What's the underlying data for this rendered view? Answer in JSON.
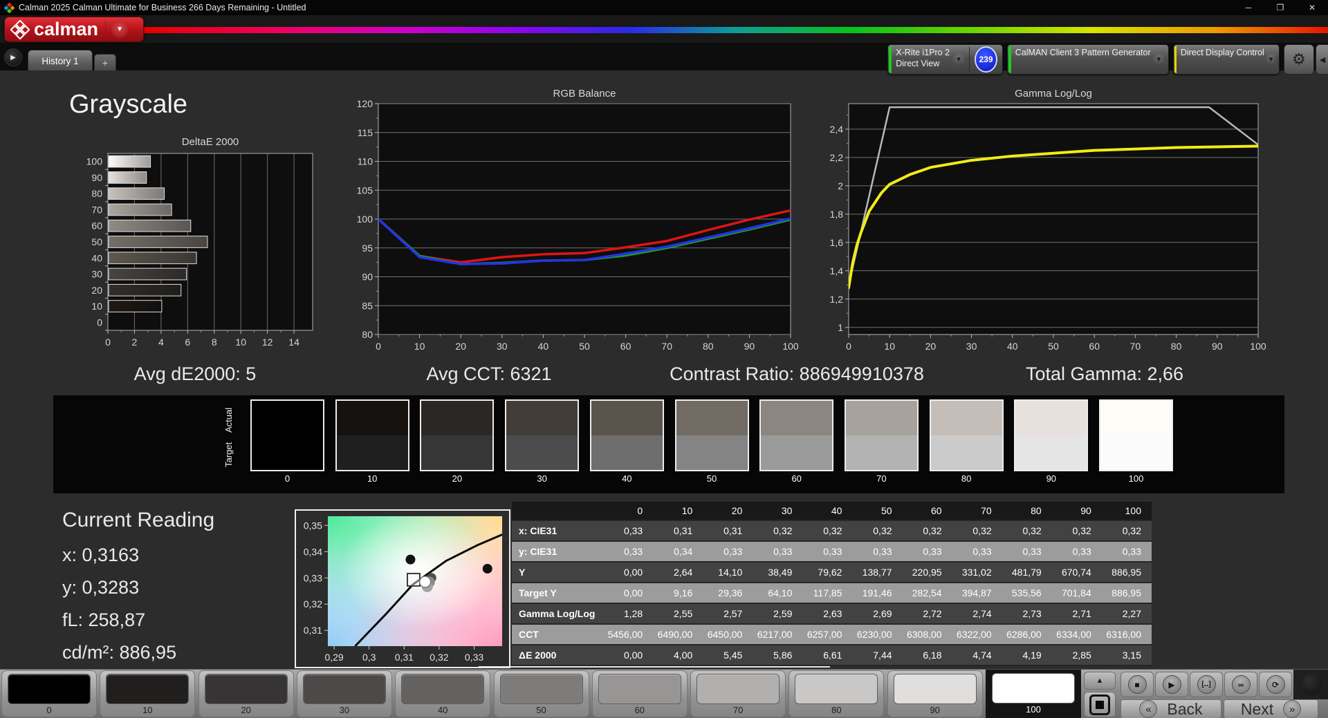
{
  "window": {
    "title": "Calman 2025 Calman Ultimate for Business 266 Days Remaining  - Untitled",
    "controls": [
      {
        "name": "minimize-button",
        "glyph": "─"
      },
      {
        "name": "maximize-button",
        "glyph": "❐"
      },
      {
        "name": "close-button",
        "glyph": "✕"
      }
    ]
  },
  "header": {
    "logo_text": "calman",
    "logo_caret_glyph": "▼",
    "panel_toggle_glyph": "▶",
    "tab": "History 1",
    "add_tab": "+",
    "gear_glyph": "⚙",
    "edge_glyph": "◀",
    "devices": [
      {
        "name": "meter-dropdown",
        "stripe": "#1ecb1e",
        "lines": [
          "X-Rite i1Pro 2",
          "Direct View"
        ],
        "badge": "239"
      },
      {
        "name": "pattern-generator-dropdown",
        "stripe": "#1ecb1e",
        "lines": [
          "CalMAN Client 3 Pattern Generator"
        ]
      },
      {
        "name": "display-control-dropdown",
        "stripe": "#e3d400",
        "lines": [
          "Direct Display Control"
        ]
      }
    ]
  },
  "page": {
    "title": "Grayscale"
  },
  "stats": {
    "avg_de": "Avg dE2000: 5",
    "avg_cct": "Avg CCT: 6321",
    "contrast": "Contrast Ratio: 886949910378",
    "total_gamma": "Total Gamma: 2,66"
  },
  "current_reading": {
    "title": "Current Reading",
    "x": "x: 0,3163",
    "y": "y: 0,3283",
    "fl": "fL: 258,87",
    "cdm2": "cd/m²: 886,95"
  },
  "swatch_strip": {
    "row_labels": [
      "Actual",
      "Target"
    ],
    "levels": [
      {
        "label": "0",
        "actual": "#000000",
        "target": "#000000"
      },
      {
        "label": "10",
        "actual": "#161210",
        "target": "#1f1f1f"
      },
      {
        "label": "20",
        "actual": "#2b2724",
        "target": "#363636"
      },
      {
        "label": "30",
        "actual": "#423d38",
        "target": "#4c4c4c"
      },
      {
        "label": "40",
        "actual": "#5a544d",
        "target": "#6e6e6e"
      },
      {
        "label": "50",
        "actual": "#716b64",
        "target": "#848484"
      },
      {
        "label": "60",
        "actual": "#8c8680",
        "target": "#9b9b9b"
      },
      {
        "label": "70",
        "actual": "#a8a29c",
        "target": "#b3b3b3"
      },
      {
        "label": "80",
        "actual": "#c5beb8",
        "target": "#cbcbcb"
      },
      {
        "label": "90",
        "actual": "#e7e0dc",
        "target": "#e5e5e5"
      },
      {
        "label": "100",
        "actual": "#fffbf7",
        "target": "#fbfbfb"
      }
    ]
  },
  "chart_data": [
    {
      "id": "deltae",
      "type": "bar",
      "orientation": "horizontal",
      "title": "DeltaE 2000",
      "categories": [
        "0",
        "10",
        "20",
        "30",
        "40",
        "50",
        "60",
        "70",
        "80",
        "90",
        "100"
      ],
      "values": [
        0.0,
        4.0,
        5.45,
        5.86,
        6.61,
        7.44,
        6.18,
        4.74,
        4.19,
        2.85,
        3.15
      ],
      "xlim": [
        0,
        15.4
      ],
      "xticks": [
        0,
        2,
        4,
        6,
        8,
        10,
        12,
        14
      ],
      "bar_colors": [
        "#0a0a0a",
        "#1d1916",
        "#322e2a",
        "#48443f",
        "#5e5750",
        "#766f68",
        "#918b85",
        "#aca69f",
        "#c9c2bc",
        "#e7e0db",
        "#fffbf8"
      ],
      "grid": "vertical"
    },
    {
      "id": "rgb-balance",
      "type": "line",
      "title": "RGB Balance",
      "x": [
        0,
        10,
        20,
        30,
        40,
        50,
        60,
        70,
        80,
        90,
        100
      ],
      "ylim": [
        80,
        120
      ],
      "yticks": [
        80,
        85,
        90,
        95,
        100,
        105,
        110,
        115,
        120
      ],
      "ytick_labels": [
        "80",
        "85",
        "90",
        "95",
        "100",
        "105",
        "110",
        "115",
        "120"
      ],
      "xticks": [
        0,
        10,
        20,
        30,
        40,
        50,
        60,
        70,
        80,
        90,
        100
      ],
      "grid": "horizontal",
      "series": [
        {
          "name": "Red",
          "color": "#e11414",
          "values": [
            100,
            93.6,
            92.5,
            93.4,
            93.9,
            94.1,
            95.1,
            96.2,
            98.1,
            99.9,
            101.5
          ]
        },
        {
          "name": "Green",
          "color": "#1ca01c",
          "values": [
            100,
            93.6,
            92.2,
            92.4,
            92.8,
            92.9,
            93.7,
            95.0,
            96.6,
            98.2,
            99.9
          ]
        },
        {
          "name": "Blue",
          "color": "#2432e8",
          "values": [
            100,
            93.4,
            92.2,
            92.3,
            92.8,
            92.9,
            94.0,
            95.2,
            96.8,
            98.4,
            100.1
          ]
        }
      ]
    },
    {
      "id": "gamma",
      "type": "line",
      "title": "Gamma Log/Log",
      "ylim": [
        0.95,
        2.58
      ],
      "yticks": [
        1,
        1.2,
        1.4,
        1.6,
        1.8,
        2,
        2.2,
        2.4
      ],
      "ytick_labels": [
        "1",
        "1,2",
        "1,4",
        "1,6",
        "1,8",
        "2",
        "2,2",
        "2,4"
      ],
      "xticks": [
        0,
        10,
        20,
        30,
        40,
        50,
        60,
        70,
        80,
        90,
        100
      ],
      "grid": "horizontal",
      "series": [
        {
          "name": "Target",
          "color": "#b8b8b8",
          "width": 2.5,
          "x": [
            0,
            10,
            88,
            100
          ],
          "values": [
            1.3,
            2.555,
            2.555,
            2.29
          ]
        },
        {
          "name": "Measured",
          "color": "#f2ec16",
          "width": 4,
          "x": [
            0,
            1,
            2,
            3,
            5,
            8,
            10,
            15,
            20,
            30,
            40,
            50,
            60,
            70,
            80,
            90,
            100
          ],
          "values": [
            1.28,
            1.46,
            1.58,
            1.67,
            1.82,
            1.95,
            2.01,
            2.08,
            2.13,
            2.18,
            2.21,
            2.23,
            2.25,
            2.26,
            2.27,
            2.275,
            2.28
          ]
        }
      ]
    },
    {
      "id": "cie",
      "type": "scatter",
      "xlim": [
        0.2882,
        0.338
      ],
      "ylim": [
        0.304,
        0.3535
      ],
      "xticks": [
        0.29,
        0.3,
        0.31,
        0.32,
        0.33
      ],
      "xtick_labels": [
        "0,29",
        "0,3",
        "0,31",
        "0,32",
        "0,33"
      ],
      "yticks": [
        0.31,
        0.32,
        0.33,
        0.34,
        0.35
      ],
      "ytick_labels": [
        "0,31",
        "0,32",
        "0,33",
        "0,34",
        "0,35"
      ],
      "locus": [
        [
          0.296,
          0.304
        ],
        [
          0.305,
          0.3165
        ],
        [
          0.3125,
          0.3275
        ],
        [
          0.322,
          0.3365
        ],
        [
          0.331,
          0.3425
        ],
        [
          0.338,
          0.3465
        ]
      ],
      "points": [
        {
          "x": 0.3118,
          "y": 0.337,
          "color": "#111111",
          "r": 7
        },
        {
          "x": 0.3338,
          "y": 0.3335,
          "color": "#111111",
          "r": 7
        },
        {
          "x": 0.3178,
          "y": 0.33,
          "color": "#4f4f4f",
          "r": 7
        },
        {
          "x": 0.3172,
          "y": 0.3284,
          "color": "#8c8c8c",
          "r": 8
        },
        {
          "x": 0.3166,
          "y": 0.3267,
          "color": "#a2a2a2",
          "r": 8
        },
        {
          "x": 0.316,
          "y": 0.3285,
          "color": "#ffffff",
          "r": 8
        }
      ],
      "target_square": {
        "x": 0.3127,
        "y": 0.3293
      }
    },
    {
      "id": "readings-table",
      "type": "table",
      "columns": [
        "",
        "0",
        "10",
        "20",
        "30",
        "40",
        "50",
        "60",
        "70",
        "80",
        "90",
        "100"
      ],
      "rows": [
        {
          "label": "x: CIE31",
          "shade": "dark",
          "values": [
            "0,33",
            "0,31",
            "0,31",
            "0,32",
            "0,32",
            "0,32",
            "0,32",
            "0,32",
            "0,32",
            "0,32",
            "0,32"
          ]
        },
        {
          "label": "y: CIE31",
          "shade": "light",
          "values": [
            "0,33",
            "0,34",
            "0,33",
            "0,33",
            "0,33",
            "0,33",
            "0,33",
            "0,33",
            "0,33",
            "0,33",
            "0,33"
          ]
        },
        {
          "label": "Y",
          "shade": "dark",
          "values": [
            "0,00",
            "2,64",
            "14,10",
            "38,49",
            "79,62",
            "138,77",
            "220,95",
            "331,02",
            "481,79",
            "670,74",
            "886,95"
          ]
        },
        {
          "label": "Target Y",
          "shade": "light",
          "values": [
            "0,00",
            "9,16",
            "29,36",
            "64,10",
            "117,85",
            "191,46",
            "282,54",
            "394,87",
            "535,56",
            "701,84",
            "886,95"
          ]
        },
        {
          "label": "Gamma Log/Log",
          "shade": "dark",
          "values": [
            "1,28",
            "2,55",
            "2,57",
            "2,59",
            "2,63",
            "2,69",
            "2,72",
            "2,74",
            "2,73",
            "2,71",
            "2,27"
          ]
        },
        {
          "label": "CCT",
          "shade": "light",
          "values": [
            "5456,00",
            "6490,00",
            "6450,00",
            "6217,00",
            "6257,00",
            "6230,00",
            "6308,00",
            "6322,00",
            "6286,00",
            "6334,00",
            "6316,00"
          ]
        },
        {
          "label": "ΔE 2000",
          "shade": "dark",
          "values": [
            "0,00",
            "4,00",
            "5,45",
            "5,86",
            "6,61",
            "7,44",
            "6,18",
            "4,74",
            "4,19",
            "2,85",
            "3,15"
          ]
        }
      ]
    }
  ],
  "transport": {
    "patches": [
      {
        "label": "0",
        "color": "#000000"
      },
      {
        "label": "10",
        "color": "#211f1e"
      },
      {
        "label": "20",
        "color": "#363434"
      },
      {
        "label": "30",
        "color": "#4c4a49"
      },
      {
        "label": "40",
        "color": "#636261"
      },
      {
        "label": "50",
        "color": "#7d7c7b"
      },
      {
        "label": "60",
        "color": "#979695"
      },
      {
        "label": "70",
        "color": "#b1b0af"
      },
      {
        "label": "80",
        "color": "#c9c8c7"
      },
      {
        "label": "90",
        "color": "#e0dfde"
      },
      {
        "label": "100",
        "color": "#ffffff",
        "selected": true
      }
    ],
    "up_glyph": "▲",
    "icons": [
      {
        "name": "stop-icon",
        "glyph": "■"
      },
      {
        "name": "play-icon",
        "glyph": "▶"
      },
      {
        "name": "measure-icon",
        "glyph": "[‥]"
      },
      {
        "name": "continuous-icon",
        "glyph": "∞"
      },
      {
        "name": "refresh-icon",
        "glyph": "⟳"
      }
    ],
    "back": "Back",
    "next": "Next",
    "back_chev": "«",
    "next_chev": "»"
  }
}
